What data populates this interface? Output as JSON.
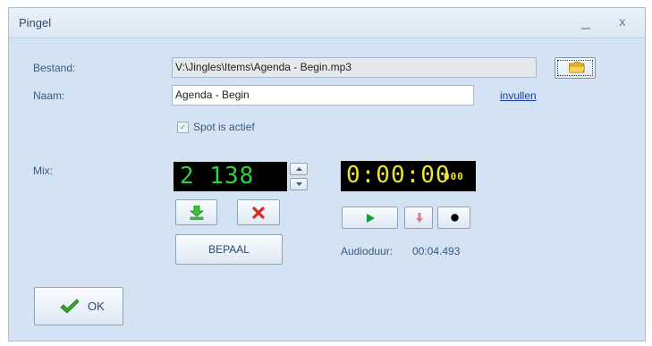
{
  "window": {
    "title": "Pingel"
  },
  "titlebar": {
    "minimize": "_",
    "close": "x"
  },
  "form": {
    "bestand_label": "Bestand:",
    "bestand_value": "V:\\Jingles\\Items\\Agenda - Begin.mp3",
    "naam_label": "Naam:",
    "naam_value": "Agenda - Begin",
    "invullen_link": "invullen",
    "spot_actief_label": "Spot is actief",
    "spot_actief_checked": true,
    "mix_label": "Mix:"
  },
  "mix": {
    "display": "2 138"
  },
  "player": {
    "time_display": "0:00:00",
    "ms_display": "000",
    "audioduur_label": "Audioduur:",
    "audioduur_value": "00:04.493"
  },
  "buttons": {
    "bepaal": "BEPAAL",
    "ok": "OK"
  },
  "icons": {
    "folder": "folder-icon",
    "accept": "download-arrow-icon",
    "reject": "red-x-icon",
    "play": "play-icon",
    "down": "down-arrow-icon",
    "record": "record-icon",
    "ok": "checkmark-icon"
  },
  "colors": {
    "window_bg": "#d4e3f3",
    "lcd_green": "#2dd33c",
    "lcd_yellow": "#ece52f",
    "play_green": "#1a9a2a",
    "checkmark_green": "#3aa52f"
  }
}
